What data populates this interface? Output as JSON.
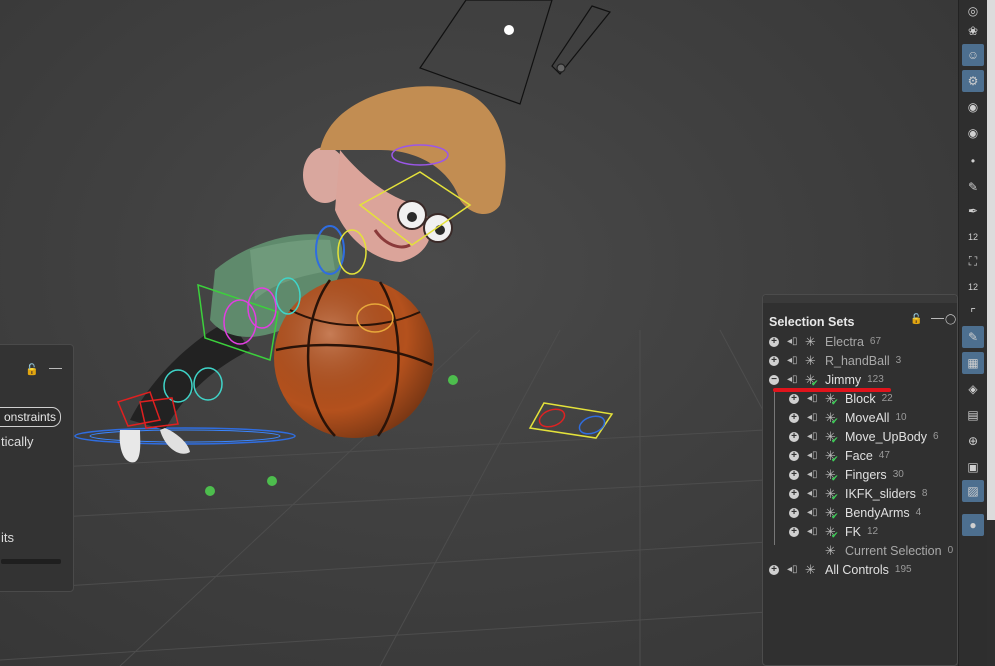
{
  "selection_sets": {
    "title": "Selection Sets",
    "rows": [
      {
        "name": "Electra",
        "count": "67",
        "expander": "+",
        "checked": false,
        "indent": 0,
        "dim": true
      },
      {
        "name": "R_handBall",
        "count": "3",
        "expander": "+",
        "checked": false,
        "indent": 0,
        "dim": true
      },
      {
        "name": "Jimmy",
        "count": "123",
        "expander": "−",
        "checked": true,
        "indent": 0,
        "dim": false
      },
      {
        "name": "Block",
        "count": "22",
        "expander": "+",
        "checked": true,
        "indent": 1,
        "dim": false
      },
      {
        "name": "MoveAll",
        "count": "10",
        "expander": "+",
        "checked": true,
        "indent": 1,
        "dim": false
      },
      {
        "name": "Move_UpBody",
        "count": "6",
        "expander": "+",
        "checked": true,
        "indent": 1,
        "dim": false
      },
      {
        "name": "Face",
        "count": "47",
        "expander": "+",
        "checked": true,
        "indent": 1,
        "dim": false
      },
      {
        "name": "Fingers",
        "count": "30",
        "expander": "+",
        "checked": true,
        "indent": 1,
        "dim": false
      },
      {
        "name": "IKFK_sliders",
        "count": "8",
        "expander": "+",
        "checked": true,
        "indent": 1,
        "dim": false
      },
      {
        "name": "BendyArms",
        "count": "4",
        "expander": "+",
        "checked": true,
        "indent": 1,
        "dim": false
      },
      {
        "name": "FK",
        "count": "12",
        "expander": "+",
        "checked": true,
        "indent": 1,
        "dim": false
      },
      {
        "name": "Current Selection",
        "count": "0",
        "expander": "",
        "checked": false,
        "indent": 1,
        "dim": true
      },
      {
        "name": "All Controls",
        "count": "195",
        "expander": "+",
        "checked": false,
        "indent": 0,
        "dim": false
      }
    ]
  },
  "left_panel": {
    "pill_label": "onstraints",
    "text1": "tically",
    "text2": "its"
  },
  "toolbar": {
    "icons": [
      "light-bulb-icon",
      "bulb-outline-icon",
      "skull-icon",
      "skull-gear-icon",
      "eye-arrow-icon",
      "eye-gear-icon",
      "dot-icon",
      "brush-icon",
      "pen-icon",
      "timing-12-icon",
      "paint-bucket-icon",
      "timing-12b-icon",
      "corner-icon",
      "pen-active-icon",
      "checker-icon",
      "layer-icon",
      "map-icon",
      "pivot-icon",
      "stack-icon",
      "landscape-icon",
      "pin-icon"
    ],
    "labels": {
      "timing": "12"
    }
  },
  "colors": {
    "accent_active": "#4d6f8f",
    "highlight_red": "#e0141c",
    "check_green": "#3fd25a"
  }
}
